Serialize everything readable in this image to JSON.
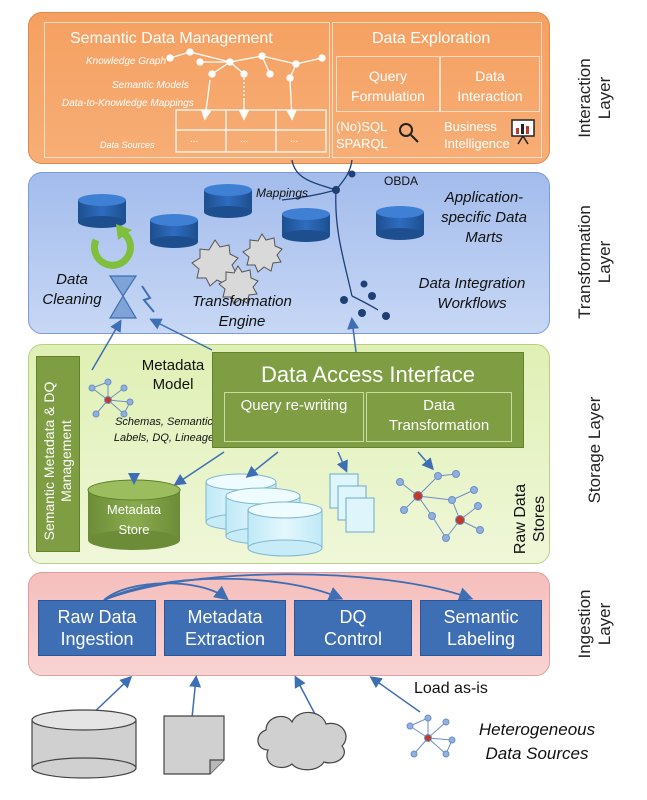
{
  "layers": {
    "interaction": "Interaction Layer",
    "transformation": "Transformation Layer",
    "storage": "Storage Layer",
    "ingestion": "Ingestion Layer"
  },
  "interaction": {
    "semantic_title": "Semantic Data Management",
    "knowledge_graph": "Knowledge Graph",
    "semantic_models": "Semantic Models",
    "mappings_label": "Data-to-Knowledge Mappings",
    "data_sources": "Data Sources",
    "table_cells": [
      "...",
      "...",
      "..."
    ],
    "exploration_title": "Data Exploration",
    "query_formulation": "Query Formulation",
    "data_interaction": "Data Interaction",
    "nosql": "(No)SQL SPARQL",
    "business_intelligence": "Business Intelligence"
  },
  "transformation": {
    "obda": "OBDA",
    "mappings": "Mappings",
    "data_marts": "Application-specific Data Marts",
    "data_cleaning": "Data Cleaning",
    "transformation_engine": "Transformation Engine",
    "integration_workflows": "Data Integration Workflows"
  },
  "storage": {
    "semantic_metadata": "Semantic Metadata & DQ Management",
    "metadata_model": "Metadata Model",
    "metadata_details": "Schemas, Semantic Labels, DQ, Lineage",
    "metadata_store": "Metadata Store",
    "data_access_interface": "Data Access Interface",
    "query_rewriting": "Query re-writing",
    "data_transformation": "Data Transformation",
    "raw_data_stores": "Raw Data Stores"
  },
  "ingestion": {
    "raw_data_ingestion": "Raw Data Ingestion",
    "metadata_extraction": "Metadata Extraction",
    "dq_control": "DQ Control",
    "semantic_labeling": "Semantic Labeling"
  },
  "sources": {
    "load_as_is": "Load as-is",
    "heterogeneous": "Heterogeneous Data Sources"
  },
  "colors": {
    "interaction": "#f7a463",
    "transformation": "#a9c3ee",
    "storage": "#e5f1c2",
    "ingestion": "#f6c7c4",
    "accent_blue": "#3e6eb4",
    "accent_green": "#7f9e43"
  }
}
